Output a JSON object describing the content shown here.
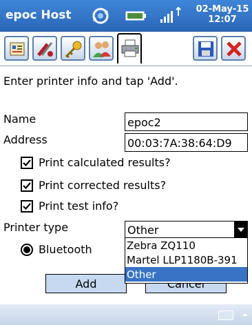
{
  "titlebar": {
    "title": "epoc Host",
    "date": "02-May-15",
    "time": "12:07"
  },
  "toolbar": {
    "buttons": [
      {
        "icon": "test-card-icon"
      },
      {
        "icon": "tools-icon"
      },
      {
        "icon": "keys-icon"
      },
      {
        "icon": "users-icon"
      },
      {
        "icon": "printer-icon",
        "active": true
      },
      {
        "icon": "save-icon"
      },
      {
        "icon": "close-icon"
      }
    ]
  },
  "content": {
    "instruction": "Enter printer info and tap 'Add'.",
    "name_label": "Name",
    "name_value": "epoc2",
    "address_label": "Address",
    "address_value": "00:03:7A:38:64:D9",
    "checkboxes": [
      {
        "label": "Print calculated results?",
        "checked": true
      },
      {
        "label": "Print corrected results?",
        "checked": true
      },
      {
        "label": "Print test info?",
        "checked": true
      }
    ],
    "printer_type_label": "Printer type",
    "printer_type_value": "Other",
    "printer_type_options": [
      "Zebra ZQ110",
      "Martel LLP1180B-391",
      "Other"
    ],
    "connection_label": "Bluetooth",
    "add_label": "Add",
    "cancel_label": "Cancel"
  },
  "colors": {
    "titlebar": "#2f73c9",
    "selected_option": "#3873c6",
    "button": "#c6d9f1"
  }
}
